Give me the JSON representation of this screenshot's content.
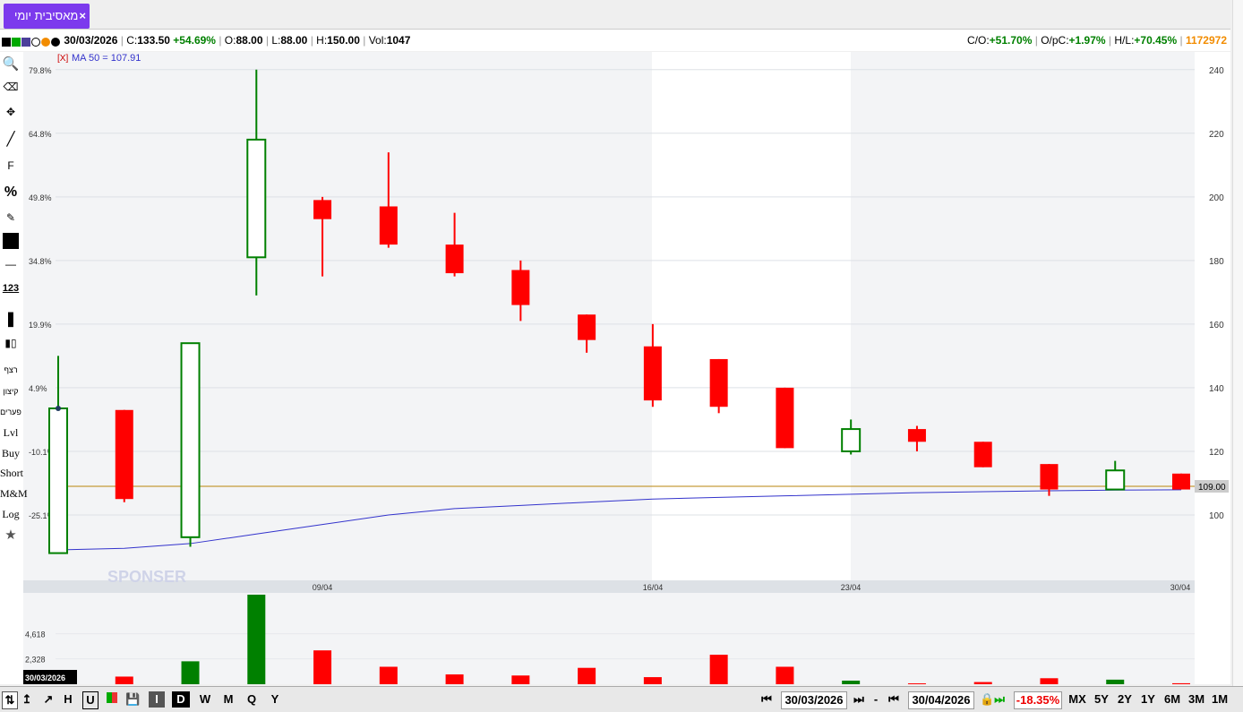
{
  "tab": {
    "title": "מאסיבית יומי",
    "close": "×"
  },
  "info": {
    "date": "30/03/2026",
    "c_label": "C:",
    "c_value": "133.50",
    "c_change": "+54.69%",
    "o_label": "O:",
    "o_value": "88.00",
    "l_label": "L:",
    "l_value": "88.00",
    "h_label": "H:",
    "h_value": "150.00",
    "vol_label": "Vol:",
    "vol_value": "1047",
    "co_label": "C/O:",
    "co_value": "+51.70%",
    "opc_label": "O/pC:",
    "opc_value": "+1.97%",
    "hl_label": "H/L:",
    "hl_value": "+70.45%",
    "id_value": "1172972"
  },
  "ma_label": "[X]",
  "ma_text": "MA 50 = 107.91",
  "tools": [
    "F",
    "%",
    "123",
    "רצף",
    "קיצון",
    "פערים",
    "Lvl",
    "Buy",
    "Short",
    "M&M",
    "Log"
  ],
  "colors": {
    "up": "#008000",
    "down": "#ff0000",
    "ma": "#3333cc",
    "level": "#b8860b",
    "accent": "#7c3aed"
  },
  "watermark": "SPONSER",
  "chart_data": {
    "type": "candlestick",
    "y_right_ticks": [
      "240",
      "220",
      "200",
      "180",
      "160",
      "140",
      "120",
      "100"
    ],
    "y_right_range": [
      80,
      245
    ],
    "y_left_ticks": [
      "79.8%",
      "64.8%",
      "49.8%",
      "34.8%",
      "19.9%",
      "4.9%",
      "-10.1%",
      "-25.1%"
    ],
    "x_ticks": [
      "09/04",
      "16/04",
      "23/04",
      "30/04"
    ],
    "current_price_label": "109.00",
    "level_line": 109,
    "candles": [
      {
        "o": 88,
        "h": 150,
        "l": 88,
        "c": 133.5
      },
      {
        "o": 133,
        "h": 133,
        "l": 104,
        "c": 105
      },
      {
        "o": 93,
        "h": 145,
        "l": 90,
        "c": 154
      },
      {
        "o": 181,
        "h": 240,
        "l": 169,
        "c": 218
      },
      {
        "o": 199,
        "h": 200,
        "l": 175,
        "c": 193
      },
      {
        "o": 197,
        "h": 214,
        "l": 184,
        "c": 185
      },
      {
        "o": 185,
        "h": 195,
        "l": 175,
        "c": 176
      },
      {
        "o": 177,
        "h": 180,
        "l": 161,
        "c": 166
      },
      {
        "o": 163,
        "h": 163,
        "l": 151,
        "c": 155
      },
      {
        "o": 153,
        "h": 160,
        "l": 134,
        "c": 136
      },
      {
        "o": 149,
        "h": 149,
        "l": 132,
        "c": 134
      },
      {
        "o": 140,
        "h": 140,
        "l": 121,
        "c": 121
      },
      {
        "o": 120,
        "h": 130,
        "l": 119,
        "c": 127
      },
      {
        "o": 127,
        "h": 128,
        "l": 120,
        "c": 123
      },
      {
        "o": 123,
        "h": 123,
        "l": 115,
        "c": 115
      },
      {
        "o": 116,
        "h": 116,
        "l": 106,
        "c": 108
      },
      {
        "o": 108,
        "h": 117,
        "l": 108,
        "c": 114
      },
      {
        "o": 113,
        "h": 113,
        "l": 108,
        "c": 108
      }
    ],
    "ma_values": [
      89,
      89.5,
      91,
      94,
      97,
      100,
      102,
      103,
      104,
      105,
      105.5,
      106,
      106.5,
      107,
      107.3,
      107.6,
      107.8,
      107.91
    ],
    "volume_ticks": [
      "4,618",
      "2,328"
    ],
    "volume": [
      0,
      700,
      2100,
      8200,
      3100,
      1600,
      900,
      800,
      1500,
      650,
      2700,
      1600,
      330,
      80,
      200,
      550,
      420,
      90
    ],
    "volume_dir": [
      "up",
      "down",
      "up",
      "up",
      "down",
      "down",
      "down",
      "down",
      "down",
      "down",
      "down",
      "down",
      "up",
      "down",
      "down",
      "down",
      "up",
      "down"
    ]
  },
  "bottom": {
    "date_label": "30/03/2026",
    "from_date": "30/03/2026",
    "to_date": "30/04/2026",
    "change": "-18.35%",
    "periods": [
      "MX",
      "5Y",
      "2Y",
      "1Y",
      "6M",
      "3M",
      "1M"
    ],
    "intervals": [
      "I",
      "D",
      "W",
      "M",
      "Q",
      "Y"
    ]
  }
}
